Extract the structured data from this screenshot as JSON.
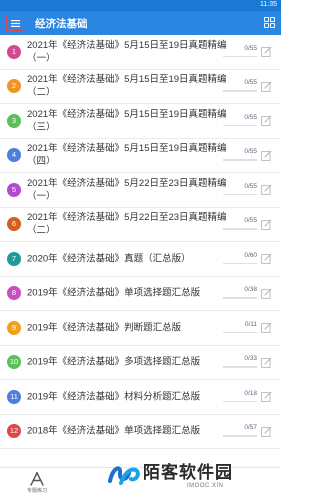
{
  "status_bar": {
    "time": "11:35"
  },
  "app_bar": {
    "title": "经济法基础"
  },
  "items": [
    {
      "number": "1",
      "color": "#d14b8f",
      "title": "2021年《经济法基础》5月15日至19日真题精编（一）",
      "done": "0",
      "total": "/55",
      "progress": 0
    },
    {
      "number": "2",
      "color": "#f0942a",
      "title": "2021年《经济法基础》5月15日至19日真题精编（二）",
      "done": "0",
      "total": "/55",
      "progress": 0
    },
    {
      "number": "3",
      "color": "#5cc05a",
      "title": "2021年《经济法基础》5月15日至19日真题精编（三）",
      "done": "0",
      "total": "/55",
      "progress": 0
    },
    {
      "number": "4",
      "color": "#4f7de0",
      "title": "2021年《经济法基础》5月15日至19日真题精编（四）",
      "done": "0",
      "total": "/55",
      "progress": 0
    },
    {
      "number": "5",
      "color": "#b14ad0",
      "title": "2021年《经济法基础》5月22日至23日真题精编（一）",
      "done": "0",
      "total": "/55",
      "progress": 0
    },
    {
      "number": "6",
      "color": "#d3601f",
      "title": "2021年《经济法基础》5月22日至23日真题精编（二）",
      "done": "0",
      "total": "/55",
      "progress": 0
    },
    {
      "number": "7",
      "color": "#1f9a9a",
      "title": "2020年《经济法基础》真题（汇总版）",
      "done": "0",
      "total": "/60",
      "progress": 0
    },
    {
      "number": "8",
      "color": "#c84fc0",
      "title": "2019年《经济法基础》单项选择题汇总版",
      "done": "0",
      "total": "/38",
      "progress": 0
    },
    {
      "number": "9",
      "color": "#f0a020",
      "title": "2019年《经济法基础》判断题汇总版",
      "done": "0",
      "total": "/11",
      "progress": 0
    },
    {
      "number": "10",
      "color": "#5cc05a",
      "title": "2019年《经济法基础》多项选择题汇总版",
      "done": "0",
      "total": "/33",
      "progress": 0
    },
    {
      "number": "11",
      "color": "#4f7de0",
      "title": "2019年《经济法基础》材料分析题汇总版",
      "done": "0",
      "total": "/18",
      "progress": 0
    },
    {
      "number": "12",
      "color": "#e04848",
      "title": "2018年《经济法基础》单项选择题汇总版",
      "done": "0",
      "total": "/57",
      "progress": 0
    }
  ],
  "bottom_bar": {
    "tab_label": "专题练习",
    "tab_icon": "practice-icon"
  },
  "watermark": {
    "text": "陌客软件园",
    "subtext": "IMOOC.XIN"
  }
}
